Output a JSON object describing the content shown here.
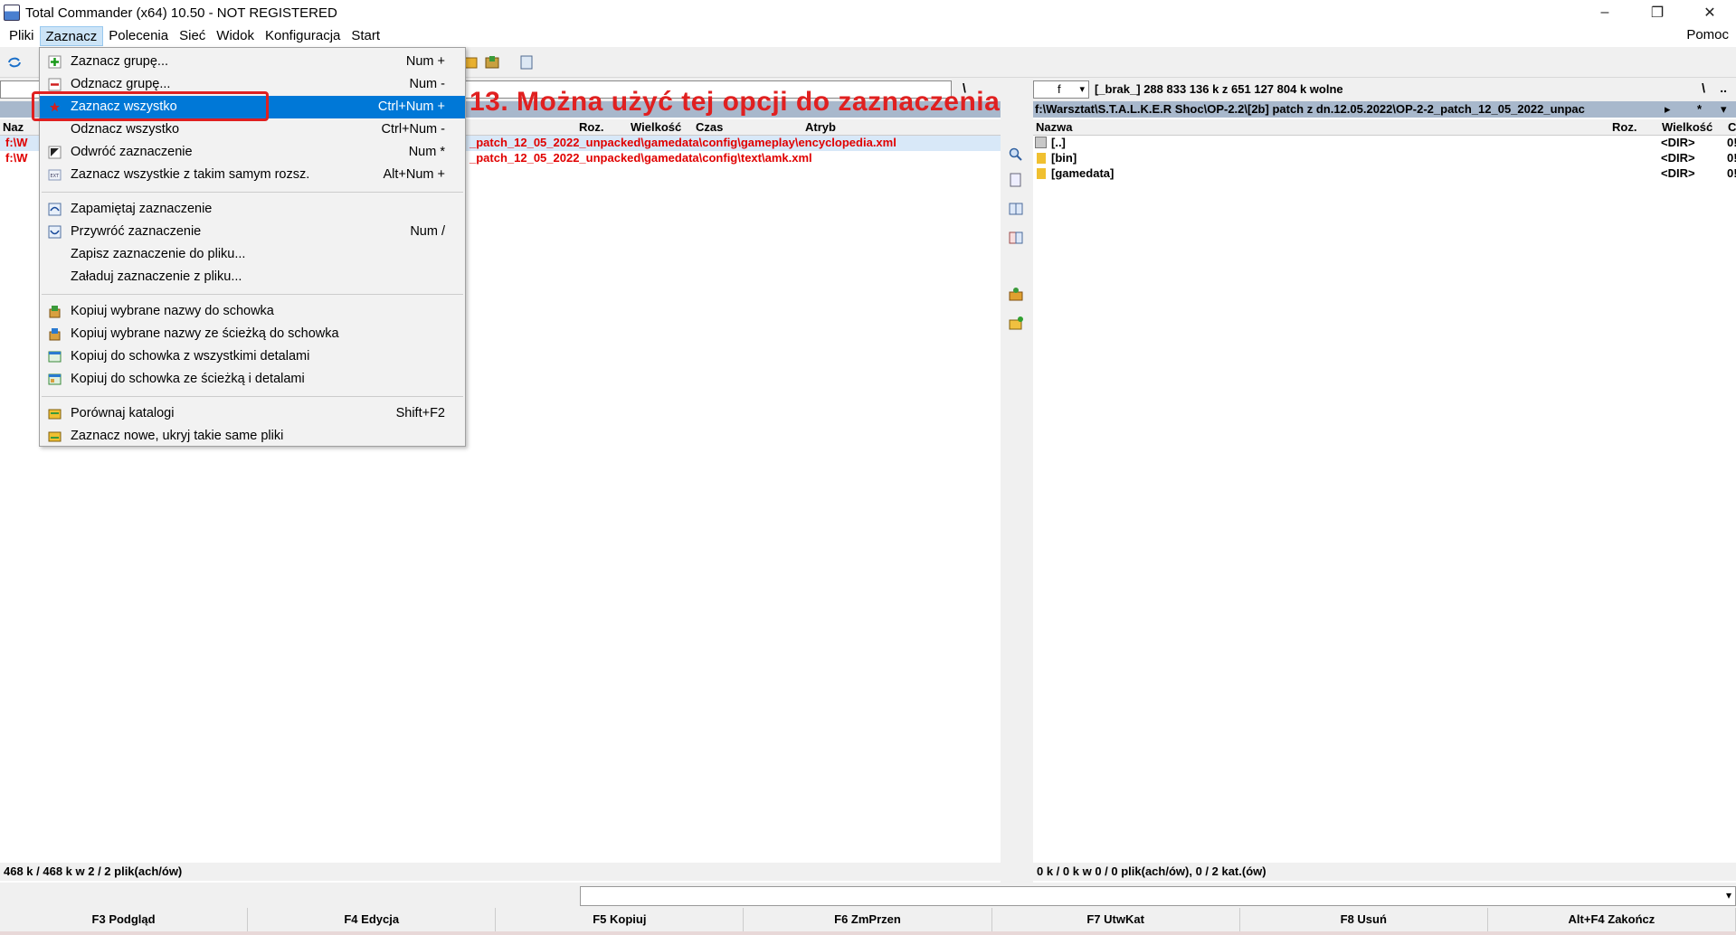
{
  "window": {
    "title": "Total Commander (x64) 10.50 - NOT REGISTERED",
    "minimize": "–",
    "restore": "❐",
    "close": "✕"
  },
  "menubar": {
    "items": [
      "Pliki",
      "Zaznacz",
      "Polecenia",
      "Sieć",
      "Widok",
      "Konfiguracja",
      "Start"
    ],
    "help": "Pomoc"
  },
  "dropdown": {
    "items": [
      {
        "label": "Zaznacz grupę...",
        "shortcut": "Num +"
      },
      {
        "label": "Odznacz grupę...",
        "shortcut": "Num -"
      },
      {
        "label": "Zaznacz wszystko",
        "shortcut": "Ctrl+Num +"
      },
      {
        "label": "Odznacz wszystko",
        "shortcut": "Ctrl+Num -"
      },
      {
        "label": "Odwróć zaznaczenie",
        "shortcut": "Num *"
      },
      {
        "label": "Zaznacz wszystkie z takim samym rozsz.",
        "shortcut": "Alt+Num +"
      },
      {
        "label": "Zapamiętaj zaznaczenie",
        "shortcut": ""
      },
      {
        "label": "Przywróć zaznaczenie",
        "shortcut": "Num /"
      },
      {
        "label": "Zapisz zaznaczenie do pliku...",
        "shortcut": ""
      },
      {
        "label": "Załaduj zaznaczenie z pliku...",
        "shortcut": ""
      },
      {
        "label": "Kopiuj wybrane nazwy do schowka",
        "shortcut": ""
      },
      {
        "label": "Kopiuj wybrane nazwy ze ścieżką do schowka",
        "shortcut": ""
      },
      {
        "label": "Kopiuj do schowka z wszystkimi detalami",
        "shortcut": ""
      },
      {
        "label": "Kopiuj do schowka ze ścieżką i detalami",
        "shortcut": ""
      },
      {
        "label": "Porównaj katalogi",
        "shortcut": "Shift+F2"
      },
      {
        "label": "Zaznacz nowe, ukryj takie same pliki",
        "shortcut": ""
      }
    ]
  },
  "annotation": "13. Można użyć tej opcji do zaznaczenia",
  "left_panel": {
    "backslash": "\\",
    "columns": {
      "name": "Naz",
      "ext": "Roz.",
      "size": "Wielkość",
      "time": "Czas",
      "attr": "Atryb"
    },
    "files": [
      {
        "prefix": "f:\\W",
        "path": "_patch_12_05_2022_unpacked\\gamedata\\config\\gameplay\\encyclopedia.xml"
      },
      {
        "prefix": "f:\\W",
        "path": "_patch_12_05_2022_unpacked\\gamedata\\config\\text\\amk.xml"
      }
    ],
    "status": "468 k / 468 k w 2 / 2 plik(ach/ów)"
  },
  "right_panel": {
    "drive": "f",
    "drive_info": "[_brak_]  288 833 136 k z 651 127 804 k wolne",
    "backslash": "\\",
    "dotdot": "..",
    "path": "f:\\Warsztat\\S.T.A.L.K.E.R Shoc\\OP-2.2\\[2b] patch z dn.12.05.2022\\OP-2-2_patch_12_05_2022_unpac",
    "path_arrow": "▸",
    "star": "*",
    "sort_arrow": "▾",
    "columns": {
      "name": "Nazwa",
      "ext": "Roz.",
      "size": "Wielkość",
      "extra": "C"
    },
    "rows": [
      {
        "name": "[..]",
        "size": "<DIR>",
        "extra": "0!"
      },
      {
        "name": "[bin]",
        "size": "<DIR>",
        "extra": "0!"
      },
      {
        "name": "[gamedata]",
        "size": "<DIR>",
        "extra": "0!"
      }
    ],
    "status": "0 k / 0 k w 0 / 0 plik(ach/ów), 0 / 2 kat.(ów)"
  },
  "fkeys": [
    "F3 Podgląd",
    "F4 Edycja",
    "F5 Kopiuj",
    "F6 ZmPrzen",
    "F7 UtwKat",
    "F8 Usuń",
    "Alt+F4 Zakończ"
  ],
  "colors": {
    "highlight": "#0078d7",
    "annotation": "#e02020",
    "file_red": "#e00000"
  }
}
